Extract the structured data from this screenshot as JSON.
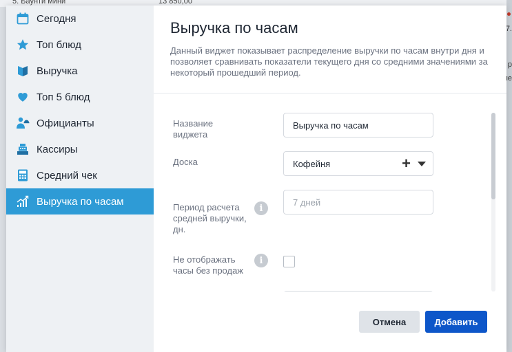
{
  "background": {
    "top_left_text": "5. Баунти мини",
    "top_mid_text": "13 850,00",
    "right_texts": [
      "7.",
      "р",
      "еле"
    ]
  },
  "sidebar": {
    "items": [
      {
        "label": "Сегодня",
        "icon": "calendar-icon"
      },
      {
        "label": "Топ блюд",
        "icon": "star-icon"
      },
      {
        "label": "Выручка",
        "icon": "book-icon"
      },
      {
        "label": "Топ 5 блюд",
        "icon": "heart-icon"
      },
      {
        "label": "Официанты",
        "icon": "waiter-icon"
      },
      {
        "label": "Кассиры",
        "icon": "cash-register-icon"
      },
      {
        "label": "Средний чек",
        "icon": "calculator-icon"
      },
      {
        "label": "Выручка по часам",
        "icon": "growth-chart-icon"
      }
    ],
    "active_index": 7
  },
  "header": {
    "title": "Выручка по часам",
    "description": "Данный виджет показывает распределение выручки по часам внутри дня и позволяет сравнивать показатели текущего дня со средними значениями за некоторый прошедший период."
  },
  "form": {
    "name_label": "Название виджета",
    "name_value": "Выручка по часам",
    "board_label": "Доска",
    "board_value": "Кофейня",
    "period_label": "Период расчета средней выручки, дн.",
    "period_placeholder": "7 дней",
    "hide_label": "Не отображать часы без продаж",
    "hide_checked": false,
    "info_glyph": "i"
  },
  "buttons": {
    "cancel": "Отмена",
    "add": "Добавить"
  },
  "colors": {
    "accent": "#2e9bd6",
    "primary_button": "#0d56c9"
  }
}
